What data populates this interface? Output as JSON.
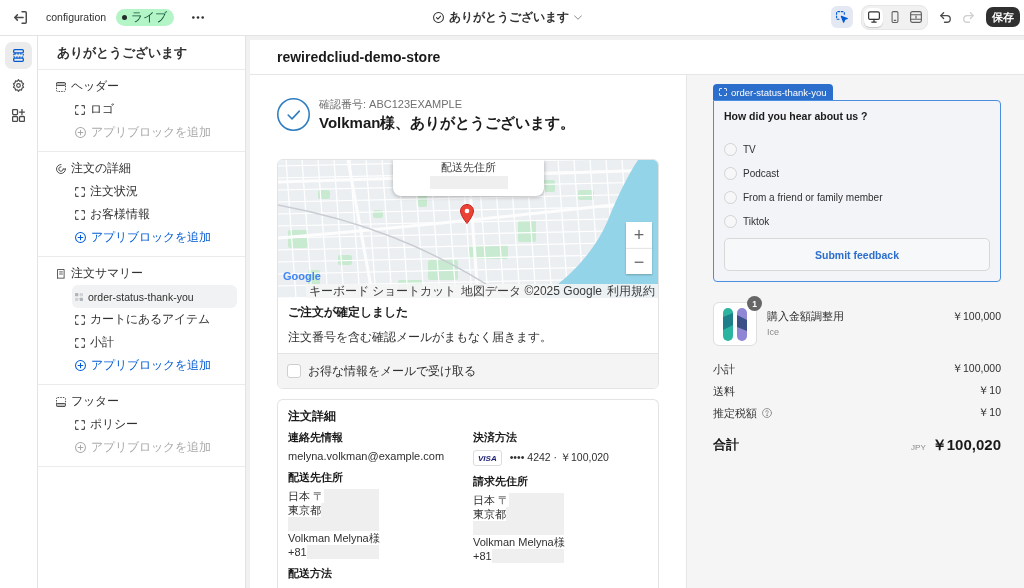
{
  "top_bar": {
    "title": "configuration",
    "status": "ライブ",
    "page": "ありがとうございます",
    "inspector": {
      "selected": true
    },
    "view_modes": [
      {
        "kind": "desktop",
        "selected": true
      },
      {
        "kind": "mobile",
        "selected": false
      },
      {
        "kind": "full_width",
        "selected": false
      }
    ],
    "history": [
      {
        "kind": "undo",
        "disabled": false
      },
      {
        "kind": "redo",
        "disabled": true
      }
    ],
    "save": "保存"
  },
  "rail": [
    {
      "kind": "sections",
      "selected": true
    },
    {
      "kind": "settings",
      "selected": false
    },
    {
      "kind": "apps",
      "selected": false
    }
  ],
  "sidebar": {
    "title": "ありがとうございます",
    "sections": [
      {
        "kind": "header",
        "label": "ヘッダー",
        "children": [
          {
            "kind": "block",
            "label": "ロゴ",
            "selected": false
          },
          {
            "kind": "add",
            "label": "アプリブロックを追加",
            "disabled": true
          }
        ]
      },
      {
        "kind": "order_details",
        "label": "注文の詳細",
        "children": [
          {
            "kind": "block",
            "label": "注文状況",
            "selected": false
          },
          {
            "kind": "block",
            "label": "お客様情報",
            "selected": false
          },
          {
            "kind": "add",
            "label": "アプリブロックを追加",
            "disabled": false
          }
        ]
      },
      {
        "kind": "order_summary",
        "label": "注文サマリー",
        "children": [
          {
            "kind": "app",
            "label": "order-status-thank-you",
            "selected": true
          },
          {
            "kind": "block",
            "label": "カートにあるアイテム",
            "selected": false
          },
          {
            "kind": "block",
            "label": "小計",
            "selected": false
          },
          {
            "kind": "add",
            "label": "アプリブロックを追加",
            "disabled": false
          }
        ]
      },
      {
        "kind": "footer",
        "label": "フッター",
        "children": [
          {
            "kind": "block",
            "label": "ポリシー",
            "selected": false
          },
          {
            "kind": "add",
            "label": "アプリブロックを追加",
            "disabled": true
          }
        ]
      }
    ]
  },
  "preview": {
    "store_name": "rewiredcliud-demo-store",
    "confirmation": {
      "number": "確認番号: ABC123EXAMPLE",
      "heading": "Volkman様、ありがとうございます。"
    },
    "map": {
      "popup": {
        "title": "配送先住所",
        "redacted": true
      },
      "zoom": [
        "+",
        "−"
      ],
      "logo": "Google",
      "attribution": [
        "キーボード ショートカット",
        "地図データ ©2025 Google",
        "利用規約"
      ]
    },
    "status": {
      "title": "ご注文が確定しました",
      "message": "注文番号を含む確認メールがまもなく届きます。",
      "opt_in": {
        "label": "お得な情報をメールで受け取る",
        "checked": false
      }
    },
    "details": {
      "title": "注文詳細",
      "columns": [
        [
          {
            "heading": "連絡先情報",
            "lines": [
              {
                "text": "melyna.volkman@example.com",
                "redacted": false
              }
            ]
          },
          {
            "heading": "配送先住所",
            "lines": [
              {
                "text": "日本 〒",
                "redacted": true
              },
              {
                "text": "東京都",
                "redacted": true
              },
              {
                "redacted": true
              },
              {
                "text": "Volkman Melyna様",
                "redacted": false
              },
              {
                "text": "+81",
                "redacted": true
              }
            ]
          },
          {
            "heading": "配送方法"
          }
        ],
        [
          {
            "heading": "決済方法",
            "payment": {
              "brand": "VISA",
              "text": "•••• 4242 · ￥100,020"
            }
          },
          {
            "heading": "請求先住所",
            "lines": [
              {
                "text": "日本 〒",
                "redacted": true
              },
              {
                "text": "東京都",
                "redacted": true
              },
              {
                "redacted": true
              },
              {
                "text": "Volkman Melyna様",
                "redacted": false
              },
              {
                "text": "+81",
                "redacted": true
              }
            ]
          }
        ]
      ]
    },
    "order_summary": {
      "app_block": {
        "tag": "order-status-thank-you",
        "question": "How did you hear about us ?",
        "options": [
          {
            "label": "TV",
            "selected": false
          },
          {
            "label": "Podcast",
            "selected": false
          },
          {
            "label": "From a friend or family member",
            "selected": false
          },
          {
            "label": "Tiktok",
            "selected": false
          }
        ],
        "submit": "Submit feedback"
      },
      "line_items": [
        {
          "name": "購入金額調整用",
          "variant": "Ice",
          "quantity": "1",
          "price": "￥100,000"
        }
      ],
      "costs": [
        {
          "label": "小計",
          "value": "￥100,000",
          "info": false
        },
        {
          "label": "送料",
          "value": "￥10",
          "info": false
        },
        {
          "label": "推定税額",
          "value": "￥10",
          "info": true
        }
      ],
      "total": {
        "label": "合計",
        "currency": "JPY",
        "value": "￥100,020"
      }
    }
  }
}
